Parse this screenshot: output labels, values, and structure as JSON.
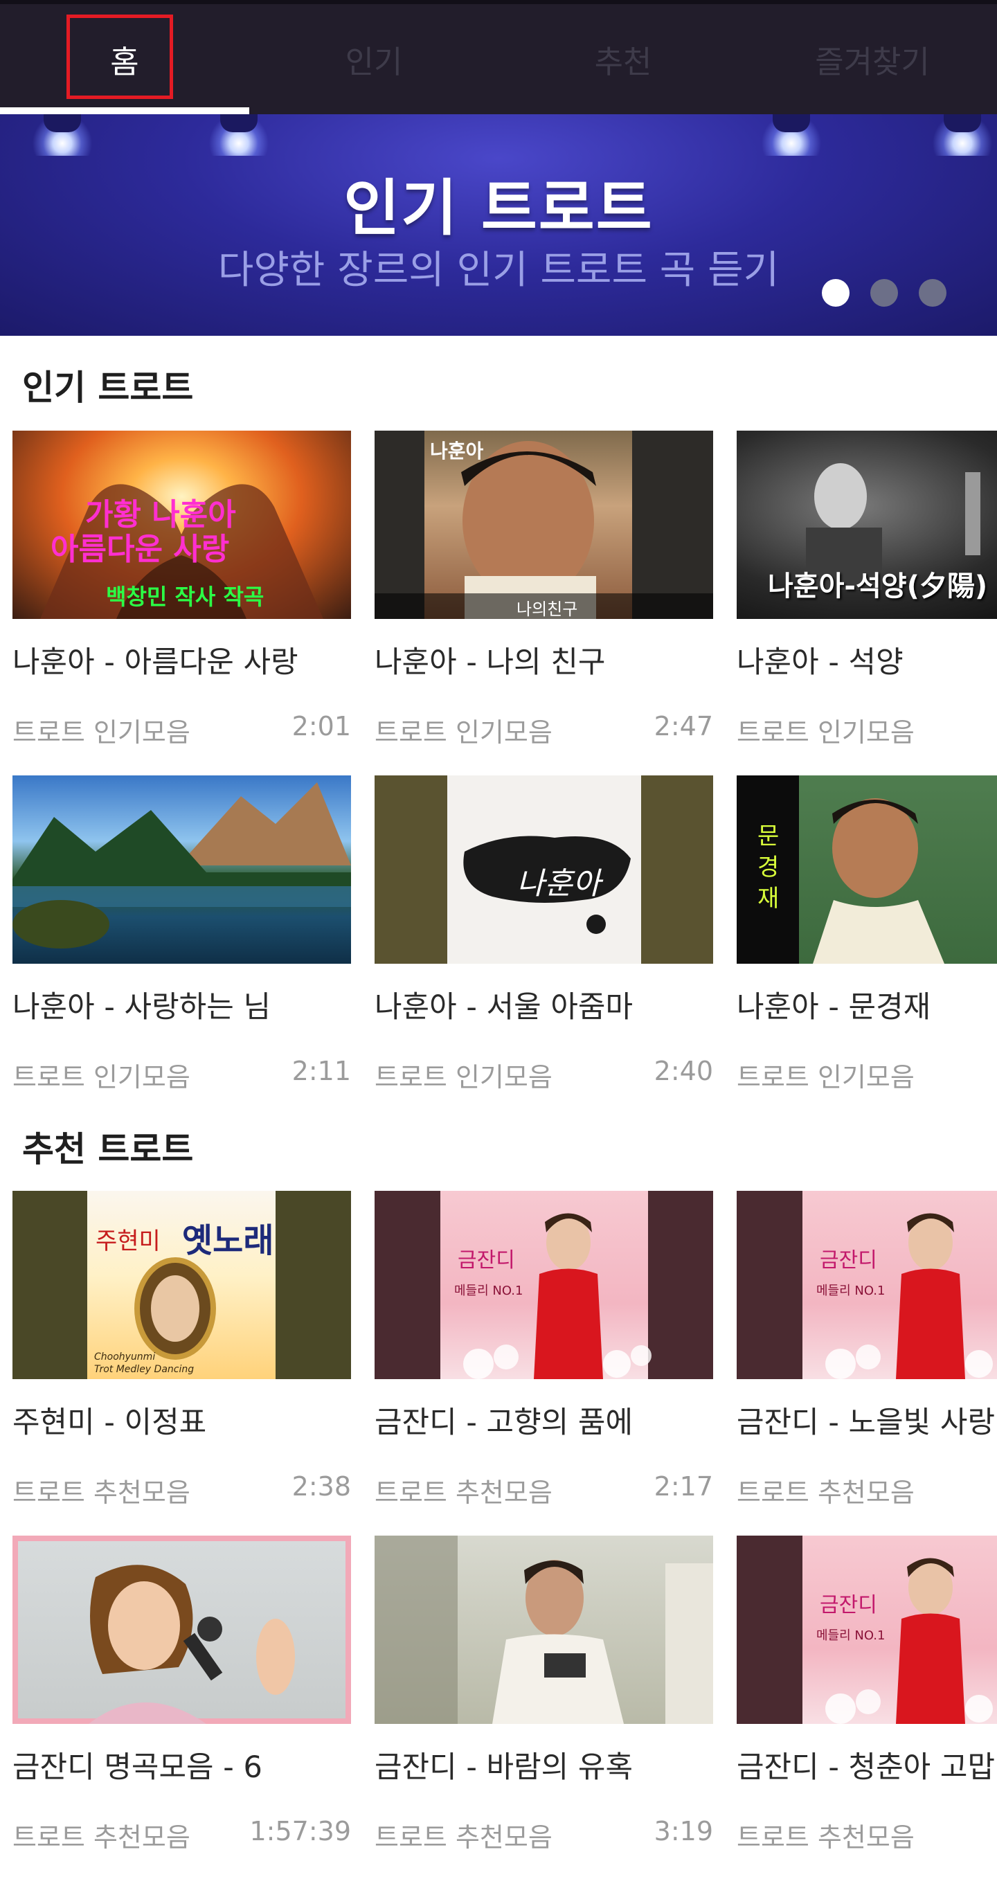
{
  "tabs": [
    {
      "label": "홈",
      "active": true
    },
    {
      "label": "인기",
      "active": false
    },
    {
      "label": "추천",
      "active": false
    },
    {
      "label": "즐겨찾기",
      "active": false
    }
  ],
  "banner": {
    "title": "인기 트로트",
    "subtitle": "다양한 장르의 인기 트로트 곡 듣기",
    "page_count": 3,
    "active_page": 1
  },
  "sections": [
    {
      "title": "인기 트로트",
      "cards": [
        {
          "title": "나훈아 - 아름다운 사랑",
          "sub": "트로트 인기모음",
          "duration": "2:01",
          "thumb_text": [
            "가황 나훈아",
            "아름다운 사랑",
            "백창민 작사 작곡"
          ]
        },
        {
          "title": "나훈아 - 나의 친구",
          "sub": "트로트 인기모음",
          "duration": "2:47",
          "thumb_text": [
            "나의친구",
            "나훈아"
          ]
        },
        {
          "title": "나훈아 - 석양",
          "sub": "트로트 인기모음",
          "duration": "",
          "thumb_text": [
            "나훈아-석양(夕陽)"
          ]
        },
        {
          "title": "나훈아 - 사랑하는 님",
          "sub": "트로트 인기모음",
          "duration": "2:11",
          "thumb_text": []
        },
        {
          "title": "나훈아 - 서울 아줌마",
          "sub": "트로트 인기모음",
          "duration": "2:40",
          "thumb_text": [
            "나훈아"
          ]
        },
        {
          "title": "나훈아 - 문경재",
          "sub": "트로트 인기모음",
          "duration": "",
          "thumb_text": [
            "문",
            "경",
            "재"
          ]
        }
      ]
    },
    {
      "title": "추천 트로트",
      "cards": [
        {
          "title": "주현미 - 이정표",
          "sub": "트로트 추천모음",
          "duration": "2:38",
          "thumb_text": [
            "주현미",
            "옛노래",
            "Choohyunmi",
            "Trot Medley Dancing"
          ]
        },
        {
          "title": "금잔디 - 고향의 품에",
          "sub": "트로트 추천모음",
          "duration": "2:17",
          "thumb_text": [
            "금잔디",
            "메들리 NO.1"
          ]
        },
        {
          "title": "금잔디 - 노을빛 사랑",
          "sub": "트로트 추천모음",
          "duration": "",
          "thumb_text": [
            "금잔디",
            "메들리 NO.1"
          ]
        },
        {
          "title": "금잔디 명곡모음 - 6",
          "sub": "트로트 추천모음",
          "duration": "1:57:39",
          "thumb_text": []
        },
        {
          "title": "금잔디 - 바람의 유혹",
          "sub": "트로트 추천모음",
          "duration": "3:19",
          "thumb_text": []
        },
        {
          "title": "금잔디 - 청춘아 고맙다",
          "sub": "트로트 추천모음",
          "duration": "",
          "thumb_text": [
            "금잔디",
            "메들리 NO.1"
          ]
        }
      ]
    }
  ]
}
